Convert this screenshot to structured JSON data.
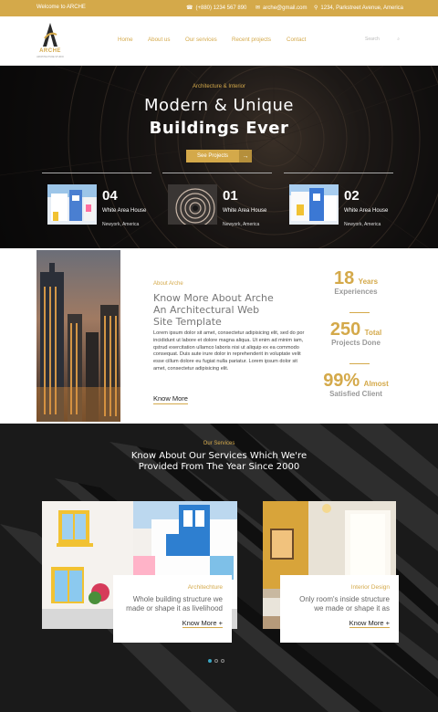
{
  "topbar": {
    "welcome": "Welcome to ARCHE",
    "phone": "(+880) 1234 567 890",
    "email": "arche@gmail.com",
    "address": "1234, Parkstreet Avenue, America"
  },
  "logo": {
    "brand": "ARCHE",
    "tagline": "ARCHITECTURE STUDIO"
  },
  "nav": {
    "items": [
      "Home",
      "About us",
      "Our services",
      "Recent projects",
      "Contact"
    ],
    "search_placeholder": "Search"
  },
  "hero": {
    "subtitle": "Architecture & Interior",
    "title_line1": "Modern & Unique",
    "title_line2": "Buildings Ever",
    "button": "See Projects",
    "projects": [
      {
        "num": "04",
        "name": "White Area House",
        "location": "Newyork, America"
      },
      {
        "num": "01",
        "name": "White Area House",
        "location": "Newyork, America"
      },
      {
        "num": "02",
        "name": "White Area House",
        "location": "Newyork, America"
      }
    ]
  },
  "about": {
    "label": "About Arche",
    "heading": "Know More About Arche An Architectural Web Site Template",
    "body": "Lorem ipsum dolor sit amet, consectetur adipisicing elit, sed do por incididunt ut labore et dolore magna aliqua. Ut enim ad minim iam, qstrud exercitation ullamco laboris nisi ut aliquip ex ea commodo consequat. Duis aute irure dolor in reprehenderit in voluptate velit esse cillum dolore eu fugiat nulla pariatur. Lorem ipsum dolor sit amet, consectetur adipisicing elit.",
    "more": "Know More",
    "stats": [
      {
        "num": "18",
        "unit": "Years",
        "desc": "Experiences"
      },
      {
        "num": "250",
        "unit": "Total",
        "desc": "Projects Done"
      },
      {
        "num": "99%",
        "unit": "Almost",
        "desc": "Satisfied Client"
      }
    ]
  },
  "services": {
    "label": "Our Services",
    "heading": "Know About Our Services Which We're Provided From The Year Since 2000",
    "cards": [
      {
        "title": "Architechture",
        "desc": "Whole building structure we made or shape it as livelihood",
        "more": "Know More +"
      },
      {
        "title": "Interior Design",
        "desc": "Only room's inside structure we made or shape it as",
        "more": "Know More +"
      }
    ],
    "active_slide": 1
  },
  "colors": {
    "accent": "#d4a94a",
    "dark": "#1c1c1c",
    "dot_active": "#3aa6c4"
  },
  "icons": [
    "phone-icon",
    "email-icon",
    "location-icon",
    "search-icon",
    "arrow-right-icon"
  ]
}
